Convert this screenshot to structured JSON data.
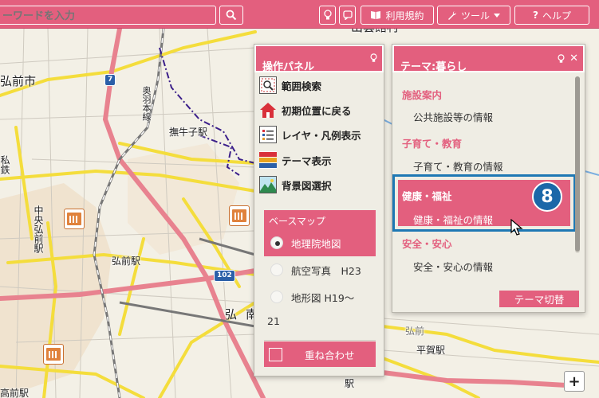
{
  "toolbar": {
    "search_placeholder": "ーワードを入力",
    "terms_label": "利用規約",
    "tools_label": "ツール",
    "help_label": "ヘルプ"
  },
  "map": {
    "labels": {
      "city": "弘前市",
      "upper_town": "出雲館村",
      "station_bugyushi": "撫牛子駅",
      "station_hirosaki": "弘前駅",
      "station_hiragagawa": "平賀駅",
      "line_ouu": "奥羽本線",
      "left_v1": "中央弘前駅",
      "left_v2": "私鉄",
      "bottom_left": "高前駅",
      "town_minami": "南",
      "town_hiro": "弘",
      "town_mid": "弘前",
      "bottom_station": "駅"
    },
    "routes": [
      "7",
      "102"
    ]
  },
  "op_panel": {
    "title": "操作パネル",
    "items": [
      {
        "label": "範囲検索",
        "icon": "magnifier-icon"
      },
      {
        "label": "初期位置に戻る",
        "icon": "home-icon"
      },
      {
        "label": "レイヤ・凡例表示",
        "icon": "layer-list-icon"
      },
      {
        "label": "テーマ表示",
        "icon": "theme-icon"
      },
      {
        "label": "背景図選択",
        "icon": "landscape-icon"
      }
    ],
    "base_map": {
      "title": "ベースマップ",
      "options": [
        {
          "label": "地理院地図",
          "selected": true
        },
        {
          "label": "航空写真　H23",
          "selected": false
        },
        {
          "label": "地形図 H19〜",
          "selected": false
        }
      ],
      "extra": "21"
    },
    "overlay_label": "重ね合わせ"
  },
  "theme_panel": {
    "title": "テーマ:暮らし",
    "categories": [
      {
        "title": "施設案内",
        "item": "公共施設等の情報"
      },
      {
        "title": "子育て・教育",
        "item": "子育て・教育の情報"
      },
      {
        "title": "健康・福祉",
        "item": "健康・福祉の情報"
      },
      {
        "title": "安全・安心",
        "item": "安全・安心の情報"
      }
    ],
    "switch_label": "テーマ切替"
  },
  "badge": "8",
  "zoom_in_label": "+",
  "colors": {
    "accent": "#e35f7e",
    "highlight_border": "#1e78b4",
    "badge": "#1b67a8"
  }
}
